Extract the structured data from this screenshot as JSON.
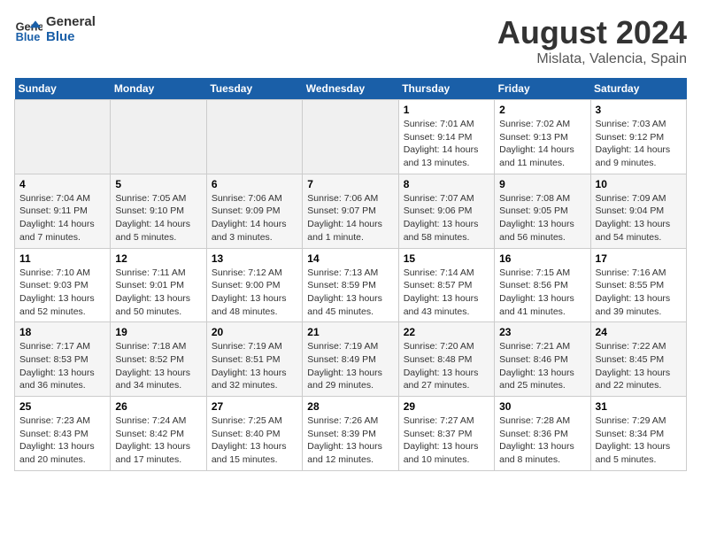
{
  "logo": {
    "text_general": "General",
    "text_blue": "Blue"
  },
  "title": "August 2024",
  "subtitle": "Mislata, Valencia, Spain",
  "days_of_week": [
    "Sunday",
    "Monday",
    "Tuesday",
    "Wednesday",
    "Thursday",
    "Friday",
    "Saturday"
  ],
  "weeks": [
    [
      {
        "day": "",
        "info": ""
      },
      {
        "day": "",
        "info": ""
      },
      {
        "day": "",
        "info": ""
      },
      {
        "day": "",
        "info": ""
      },
      {
        "day": "1",
        "info": "Sunrise: 7:01 AM\nSunset: 9:14 PM\nDaylight: 14 hours\nand 13 minutes."
      },
      {
        "day": "2",
        "info": "Sunrise: 7:02 AM\nSunset: 9:13 PM\nDaylight: 14 hours\nand 11 minutes."
      },
      {
        "day": "3",
        "info": "Sunrise: 7:03 AM\nSunset: 9:12 PM\nDaylight: 14 hours\nand 9 minutes."
      }
    ],
    [
      {
        "day": "4",
        "info": "Sunrise: 7:04 AM\nSunset: 9:11 PM\nDaylight: 14 hours\nand 7 minutes."
      },
      {
        "day": "5",
        "info": "Sunrise: 7:05 AM\nSunset: 9:10 PM\nDaylight: 14 hours\nand 5 minutes."
      },
      {
        "day": "6",
        "info": "Sunrise: 7:06 AM\nSunset: 9:09 PM\nDaylight: 14 hours\nand 3 minutes."
      },
      {
        "day": "7",
        "info": "Sunrise: 7:06 AM\nSunset: 9:07 PM\nDaylight: 14 hours\nand 1 minute."
      },
      {
        "day": "8",
        "info": "Sunrise: 7:07 AM\nSunset: 9:06 PM\nDaylight: 13 hours\nand 58 minutes."
      },
      {
        "day": "9",
        "info": "Sunrise: 7:08 AM\nSunset: 9:05 PM\nDaylight: 13 hours\nand 56 minutes."
      },
      {
        "day": "10",
        "info": "Sunrise: 7:09 AM\nSunset: 9:04 PM\nDaylight: 13 hours\nand 54 minutes."
      }
    ],
    [
      {
        "day": "11",
        "info": "Sunrise: 7:10 AM\nSunset: 9:03 PM\nDaylight: 13 hours\nand 52 minutes."
      },
      {
        "day": "12",
        "info": "Sunrise: 7:11 AM\nSunset: 9:01 PM\nDaylight: 13 hours\nand 50 minutes."
      },
      {
        "day": "13",
        "info": "Sunrise: 7:12 AM\nSunset: 9:00 PM\nDaylight: 13 hours\nand 48 minutes."
      },
      {
        "day": "14",
        "info": "Sunrise: 7:13 AM\nSunset: 8:59 PM\nDaylight: 13 hours\nand 45 minutes."
      },
      {
        "day": "15",
        "info": "Sunrise: 7:14 AM\nSunset: 8:57 PM\nDaylight: 13 hours\nand 43 minutes."
      },
      {
        "day": "16",
        "info": "Sunrise: 7:15 AM\nSunset: 8:56 PM\nDaylight: 13 hours\nand 41 minutes."
      },
      {
        "day": "17",
        "info": "Sunrise: 7:16 AM\nSunset: 8:55 PM\nDaylight: 13 hours\nand 39 minutes."
      }
    ],
    [
      {
        "day": "18",
        "info": "Sunrise: 7:17 AM\nSunset: 8:53 PM\nDaylight: 13 hours\nand 36 minutes."
      },
      {
        "day": "19",
        "info": "Sunrise: 7:18 AM\nSunset: 8:52 PM\nDaylight: 13 hours\nand 34 minutes."
      },
      {
        "day": "20",
        "info": "Sunrise: 7:19 AM\nSunset: 8:51 PM\nDaylight: 13 hours\nand 32 minutes."
      },
      {
        "day": "21",
        "info": "Sunrise: 7:19 AM\nSunset: 8:49 PM\nDaylight: 13 hours\nand 29 minutes."
      },
      {
        "day": "22",
        "info": "Sunrise: 7:20 AM\nSunset: 8:48 PM\nDaylight: 13 hours\nand 27 minutes."
      },
      {
        "day": "23",
        "info": "Sunrise: 7:21 AM\nSunset: 8:46 PM\nDaylight: 13 hours\nand 25 minutes."
      },
      {
        "day": "24",
        "info": "Sunrise: 7:22 AM\nSunset: 8:45 PM\nDaylight: 13 hours\nand 22 minutes."
      }
    ],
    [
      {
        "day": "25",
        "info": "Sunrise: 7:23 AM\nSunset: 8:43 PM\nDaylight: 13 hours\nand 20 minutes."
      },
      {
        "day": "26",
        "info": "Sunrise: 7:24 AM\nSunset: 8:42 PM\nDaylight: 13 hours\nand 17 minutes."
      },
      {
        "day": "27",
        "info": "Sunrise: 7:25 AM\nSunset: 8:40 PM\nDaylight: 13 hours\nand 15 minutes."
      },
      {
        "day": "28",
        "info": "Sunrise: 7:26 AM\nSunset: 8:39 PM\nDaylight: 13 hours\nand 12 minutes."
      },
      {
        "day": "29",
        "info": "Sunrise: 7:27 AM\nSunset: 8:37 PM\nDaylight: 13 hours\nand 10 minutes."
      },
      {
        "day": "30",
        "info": "Sunrise: 7:28 AM\nSunset: 8:36 PM\nDaylight: 13 hours\nand 8 minutes."
      },
      {
        "day": "31",
        "info": "Sunrise: 7:29 AM\nSunset: 8:34 PM\nDaylight: 13 hours\nand 5 minutes."
      }
    ]
  ]
}
